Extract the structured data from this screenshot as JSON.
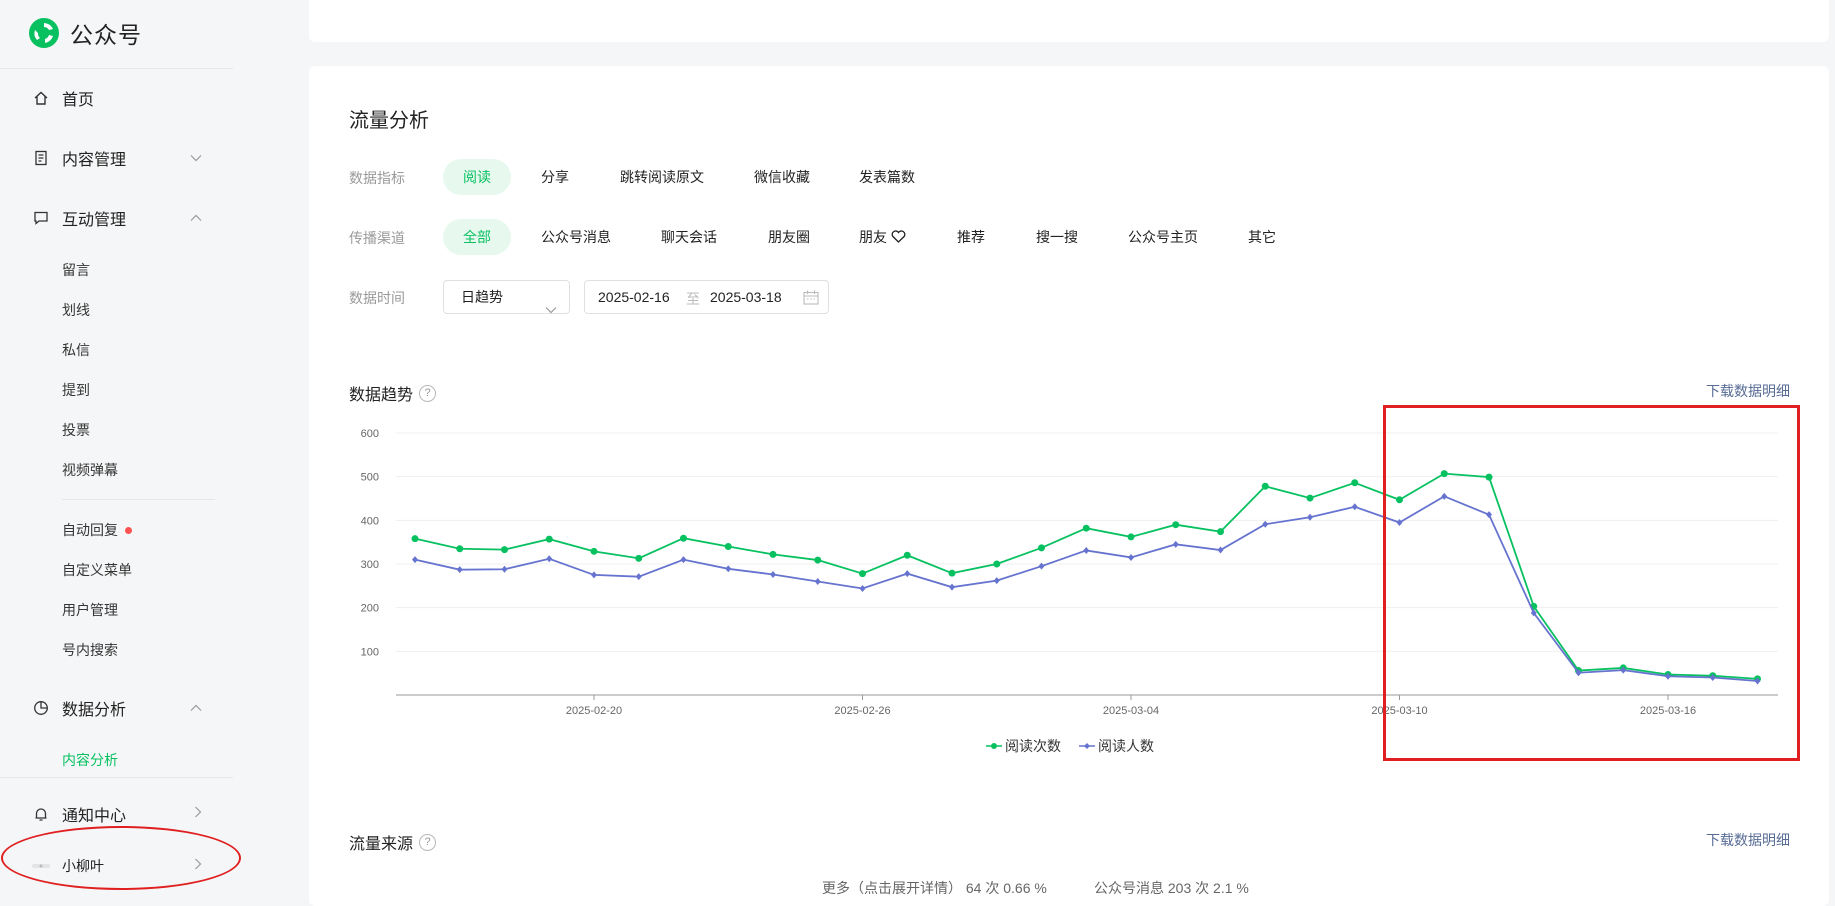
{
  "app": {
    "name": "公众号"
  },
  "sidebar": {
    "home": "首页",
    "content_mgmt": "内容管理",
    "interaction_mgmt": "互动管理",
    "interaction_items": [
      "留言",
      "划线",
      "私信",
      "提到",
      "投票",
      "视频弹幕"
    ],
    "other_items": [
      "自动回复",
      "自定义菜单",
      "用户管理",
      "号内搜索"
    ],
    "data_analysis": "数据分析",
    "content_analysis": "内容分析",
    "notifications": "通知中心",
    "account_name": "小柳叶"
  },
  "main": {
    "title": "流量分析",
    "metric_label": "数据指标",
    "metrics": [
      "阅读",
      "分享",
      "跳转阅读原文",
      "微信收藏",
      "发表篇数"
    ],
    "channel_label": "传播渠道",
    "channels": [
      "全部",
      "公众号消息",
      "聊天会话",
      "朋友圈",
      "朋友",
      "推荐",
      "搜一搜",
      "公众号主页",
      "其它"
    ],
    "time_label": "数据时间",
    "time_select": "日趋势",
    "date_start": "2025-02-16",
    "date_sep": "至",
    "date_end": "2025-03-18",
    "trend_title": "数据趋势",
    "download_link": "下载数据明细",
    "source_title": "流量来源",
    "source_more": "更多（点击展开详情） 64 次 0.66 %",
    "source_msg": "公众号消息 203 次 2.1 %"
  },
  "colors": {
    "accent": "#07c160",
    "series2": "#6673cf",
    "annotation": "#e02020"
  },
  "chart_data": {
    "type": "line",
    "x": [
      "2025-02-16",
      "2025-02-17",
      "2025-02-18",
      "2025-02-19",
      "2025-02-20",
      "2025-02-21",
      "2025-02-22",
      "2025-02-23",
      "2025-02-24",
      "2025-02-25",
      "2025-02-26",
      "2025-02-27",
      "2025-02-28",
      "2025-03-01",
      "2025-03-02",
      "2025-03-03",
      "2025-03-04",
      "2025-03-05",
      "2025-03-06",
      "2025-03-07",
      "2025-03-08",
      "2025-03-09",
      "2025-03-10",
      "2025-03-11",
      "2025-03-12",
      "2025-03-13",
      "2025-03-14",
      "2025-03-15",
      "2025-03-16",
      "2025-03-17",
      "2025-03-18"
    ],
    "x_ticks": [
      "2025-02-20",
      "2025-02-26",
      "2025-03-04",
      "2025-03-10",
      "2025-03-16"
    ],
    "y_ticks": [
      100,
      200,
      300,
      400,
      500,
      600
    ],
    "ylim": [
      0,
      600
    ],
    "series": [
      {
        "name": "阅读次数",
        "color": "#07c160",
        "values": [
          358,
          335,
          333,
          357,
          329,
          313,
          359,
          340,
          322,
          309,
          278,
          320,
          279,
          300,
          337,
          382,
          362,
          390,
          374,
          478,
          451,
          486,
          447,
          507,
          499,
          203,
          56,
          62,
          47,
          44,
          37
        ]
      },
      {
        "name": "阅读人数",
        "color": "#6673cf",
        "values": [
          310,
          287,
          288,
          312,
          275,
          271,
          310,
          289,
          276,
          260,
          244,
          278,
          247,
          262,
          295,
          331,
          315,
          345,
          332,
          391,
          407,
          431,
          395,
          455,
          413,
          188,
          51,
          57,
          43,
          40,
          32
        ]
      }
    ],
    "legend": "bottom-center",
    "grid": true
  }
}
